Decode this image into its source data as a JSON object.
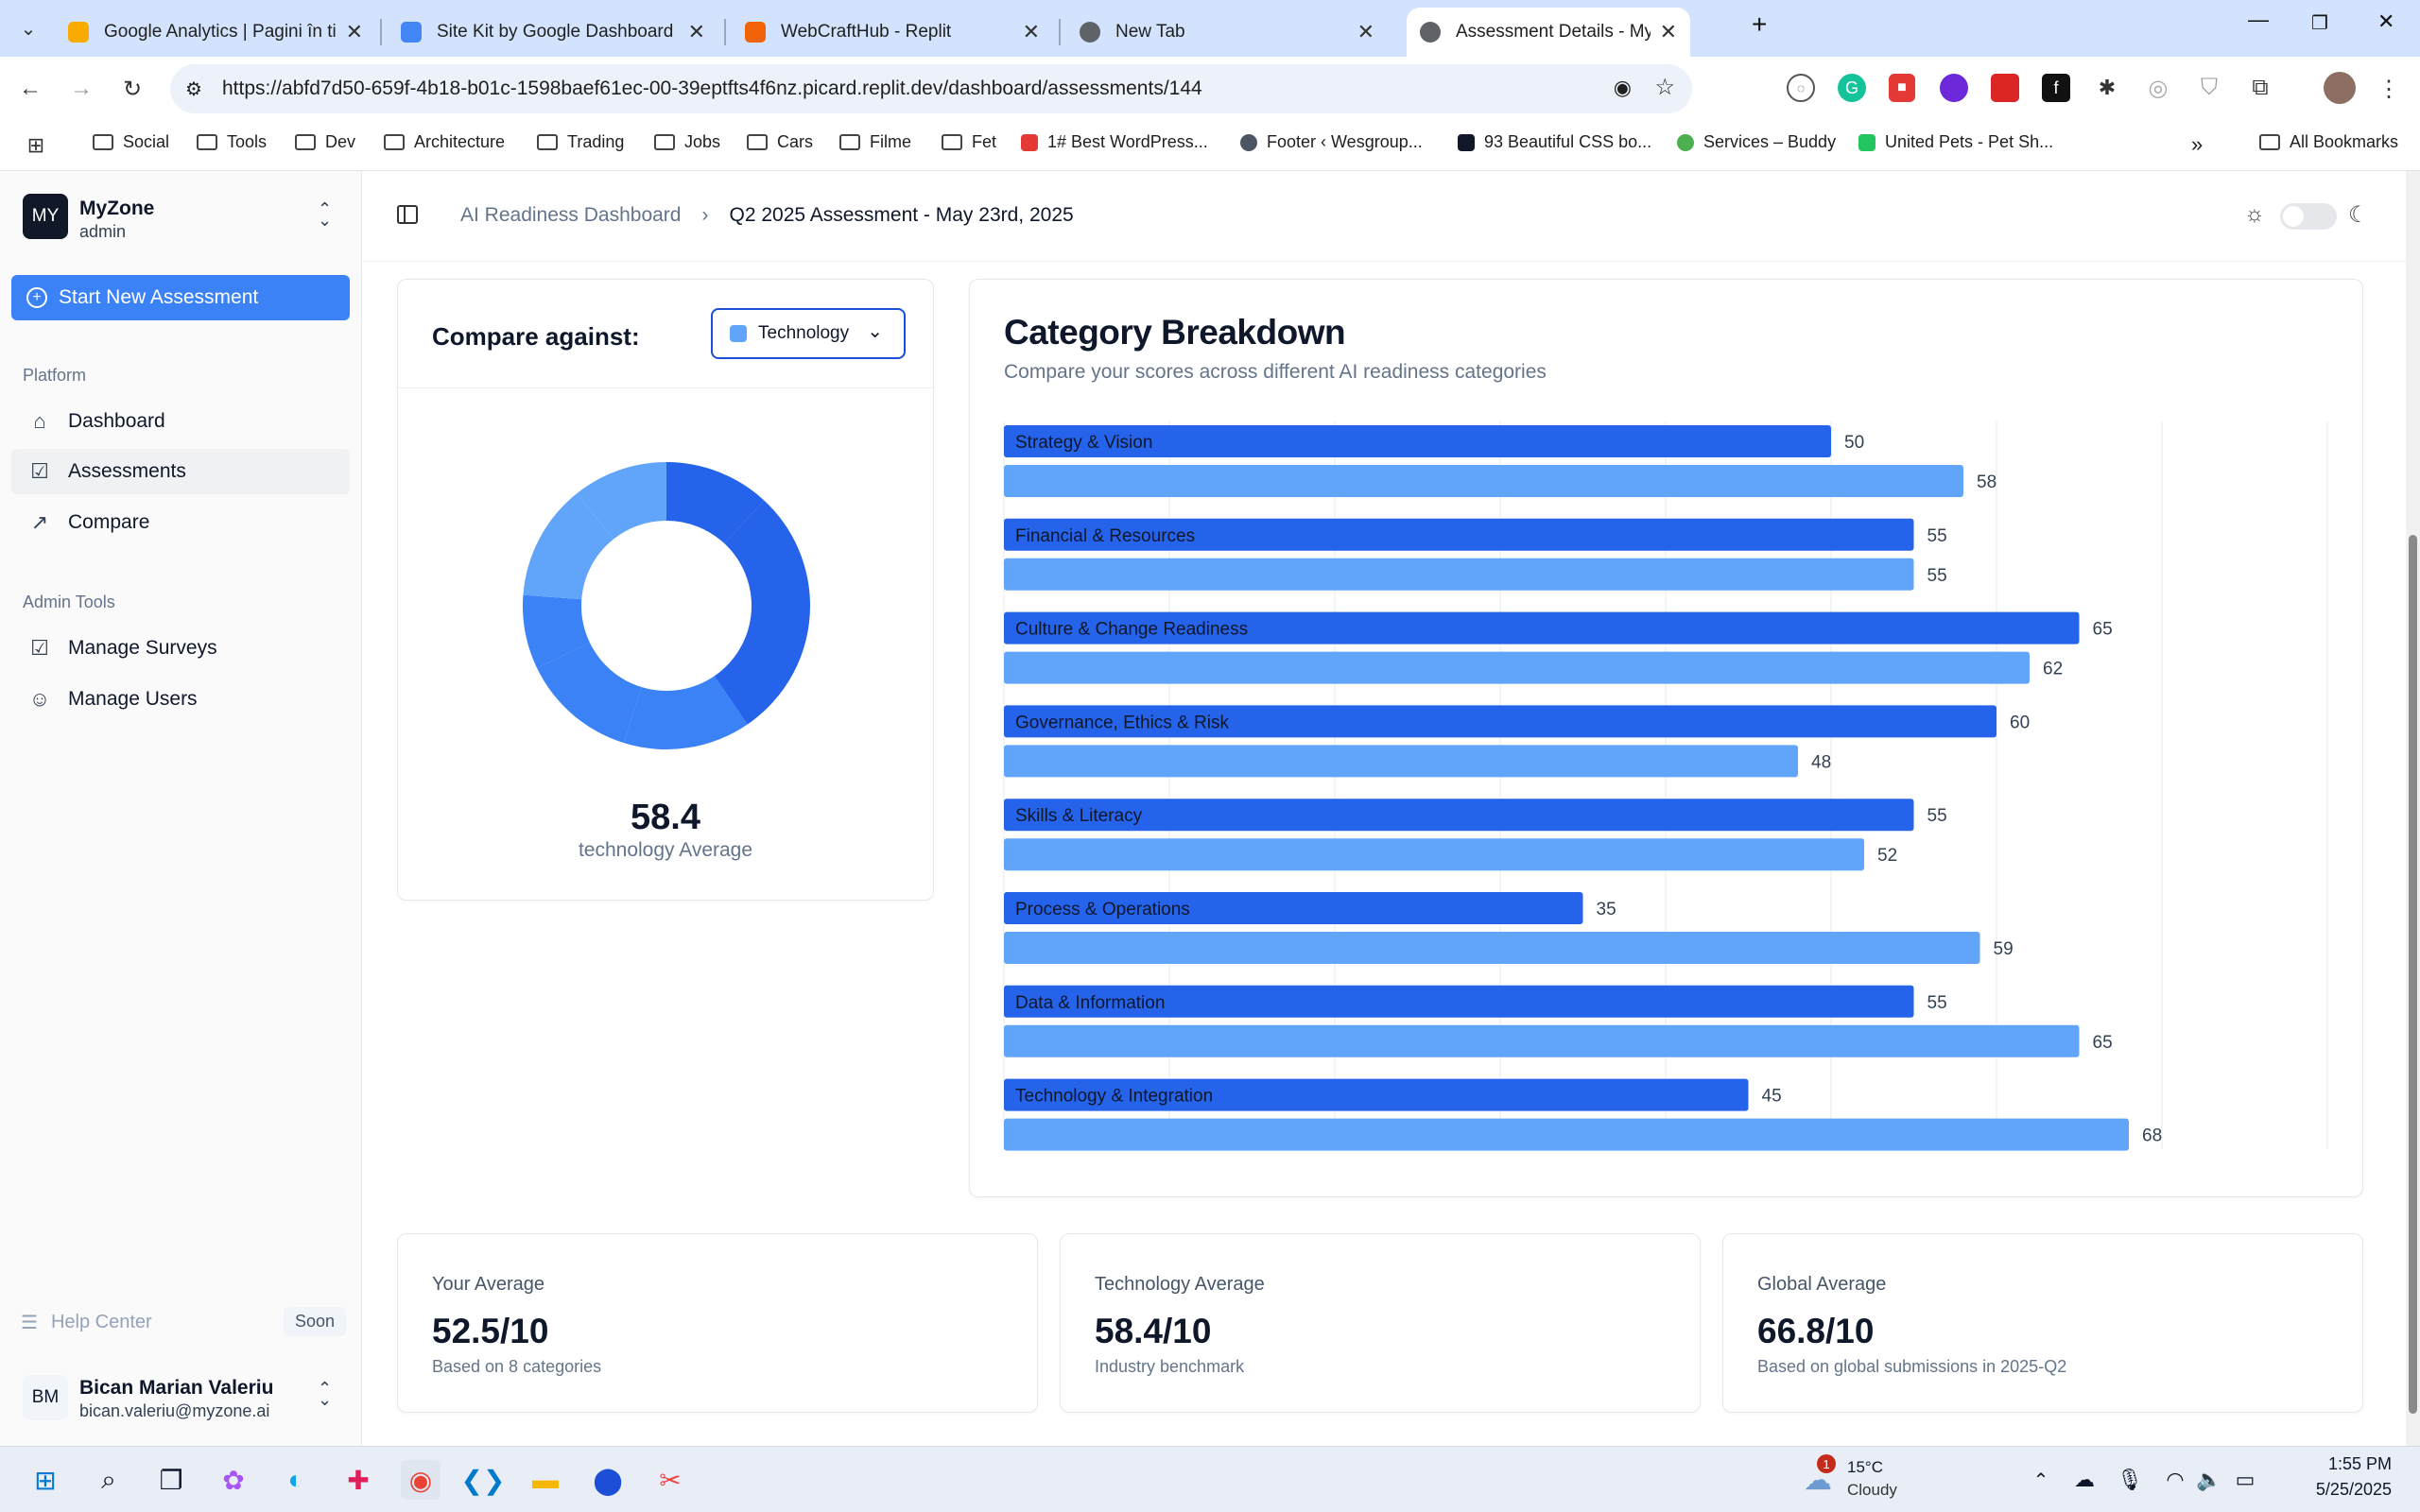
{
  "browser": {
    "tabs": [
      {
        "title": "Google Analytics | Pagini în timp",
        "favicon_color": "#f9ab00"
      },
      {
        "title": "Site Kit by Google Dashboard ‹",
        "favicon_color": "#4285f4"
      },
      {
        "title": "WebCraftHub - Replit",
        "favicon_color": "#f26207"
      },
      {
        "title": "New Tab",
        "favicon_color": "#5f6368"
      },
      {
        "title": "Assessment Details - MyZone A",
        "favicon_color": "#5f6368"
      }
    ],
    "url": "https://abfd7d50-659f-4b18-b01c-1598baef61ec-00-39eptfts4f6nz.picard.replit.dev/dashboard/assessments/144",
    "bookmarks": [
      {
        "label": "Social",
        "type": "folder"
      },
      {
        "label": "Tools",
        "type": "folder"
      },
      {
        "label": "Dev",
        "type": "folder"
      },
      {
        "label": "Architecture",
        "type": "folder"
      },
      {
        "label": "Trading",
        "type": "folder"
      },
      {
        "label": "Jobs",
        "type": "folder"
      },
      {
        "label": "Cars",
        "type": "folder"
      },
      {
        "label": "Filme",
        "type": "folder"
      },
      {
        "label": "Fet",
        "type": "folder"
      },
      {
        "label": "1# Best WordPress...",
        "type": "link",
        "color": "#e53935"
      },
      {
        "label": "Footer ‹ Wesgroup...",
        "type": "link",
        "color": "#4b5563"
      },
      {
        "label": "93 Beautiful CSS bo...",
        "type": "link",
        "color": "#111827"
      },
      {
        "label": "Services – Buddy",
        "type": "link",
        "color": "#4caf50"
      },
      {
        "label": "United Pets - Pet Sh...",
        "type": "link",
        "color": "#22c55e"
      }
    ],
    "all_bookmarks": "All Bookmarks"
  },
  "sidebar": {
    "logo": "MY",
    "org_name": "MyZone",
    "org_role": "admin",
    "new_assessment": "Start New Assessment",
    "platform_label": "Platform",
    "platform_items": [
      {
        "label": "Dashboard",
        "icon": "home-icon"
      },
      {
        "label": "Assessments",
        "icon": "clipboard-icon"
      },
      {
        "label": "Compare",
        "icon": "trending-icon"
      }
    ],
    "admin_label": "Admin Tools",
    "admin_items": [
      {
        "label": "Manage Surveys",
        "icon": "clipboard-icon"
      },
      {
        "label": "Manage Users",
        "icon": "users-icon"
      }
    ],
    "help_center": "Help Center",
    "help_badge": "Soon",
    "user_initials": "BM",
    "user_name": "Bican Marian Valeriu",
    "user_email": "bican.valeriu@myzone.ai"
  },
  "breadcrumb": {
    "parent": "AI Readiness Dashboard",
    "current": "Q2 2025 Assessment - May 23rd, 2025"
  },
  "compare": {
    "label": "Compare against:",
    "selected": "Technology",
    "selected_color": "#60a5fa",
    "average_value": "58.4",
    "average_label": "technology Average"
  },
  "breakdown": {
    "title": "Category Breakdown",
    "subtitle": "Compare your scores across different AI readiness categories"
  },
  "chart_data": {
    "type": "bar",
    "orientation": "horizontal",
    "categories": [
      "Strategy & Vision",
      "Financial & Resources",
      "Culture & Change Readiness",
      "Governance, Ethics & Risk",
      "Skills & Literacy",
      "Process & Operations",
      "Data & Information",
      "Technology & Integration"
    ],
    "series": [
      {
        "values": [
          50,
          55,
          65,
          60,
          55,
          35,
          55,
          45
        ],
        "color": "#2563eb"
      },
      {
        "values": [
          58,
          55,
          62,
          48,
          52,
          59,
          65,
          68
        ],
        "color": "#60a5fa"
      }
    ],
    "xlim": [
      0,
      80
    ],
    "grid": true
  },
  "donut_data": {
    "type": "pie",
    "values": [
      50,
      55,
      65,
      60,
      55,
      35,
      55,
      45
    ],
    "colors": [
      "#2563eb",
      "#3b82f6",
      "#60a5fa"
    ]
  },
  "stats": [
    {
      "label": "Your Average",
      "value": "52.5/10",
      "note": "Based on 8 categories"
    },
    {
      "label": "Technology Average",
      "value": "58.4/10",
      "note": "Industry benchmark"
    },
    {
      "label": "Global Average",
      "value": "66.8/10",
      "note": "Based on global submissions in 2025-Q2"
    }
  ],
  "taskbar": {
    "weather_temp": "15°C",
    "weather_desc": "Cloudy",
    "weather_badge": "1",
    "time": "1:55 PM",
    "date": "5/25/2025"
  }
}
